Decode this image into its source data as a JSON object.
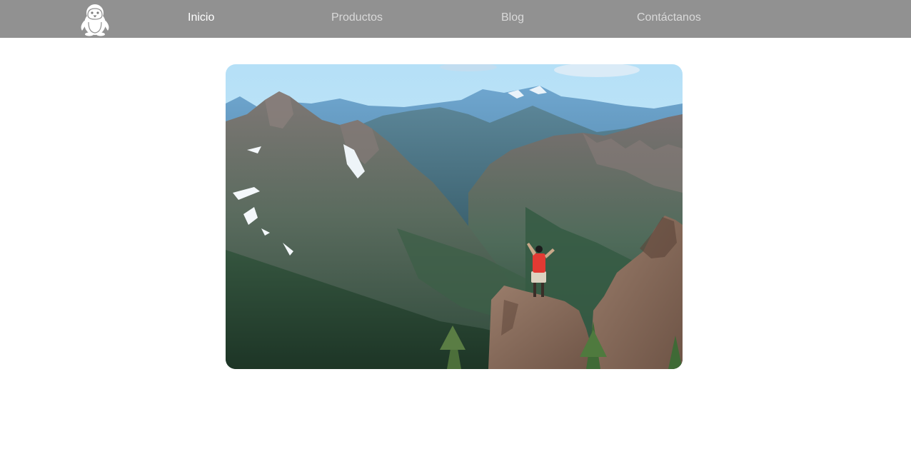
{
  "nav": {
    "logo_icon": "penguin-icon",
    "items": [
      {
        "label": "Inicio",
        "active": true
      },
      {
        "label": "Productos",
        "active": false
      },
      {
        "label": "Blog",
        "active": false
      },
      {
        "label": "Contáctanos",
        "active": false
      }
    ]
  },
  "hero": {
    "subject": "mountain-hiker-photo"
  },
  "colors": {
    "navbar": "#919191",
    "nav_text": "#d9d9d9",
    "nav_active": "#ffffff",
    "background": "#ffffff"
  }
}
